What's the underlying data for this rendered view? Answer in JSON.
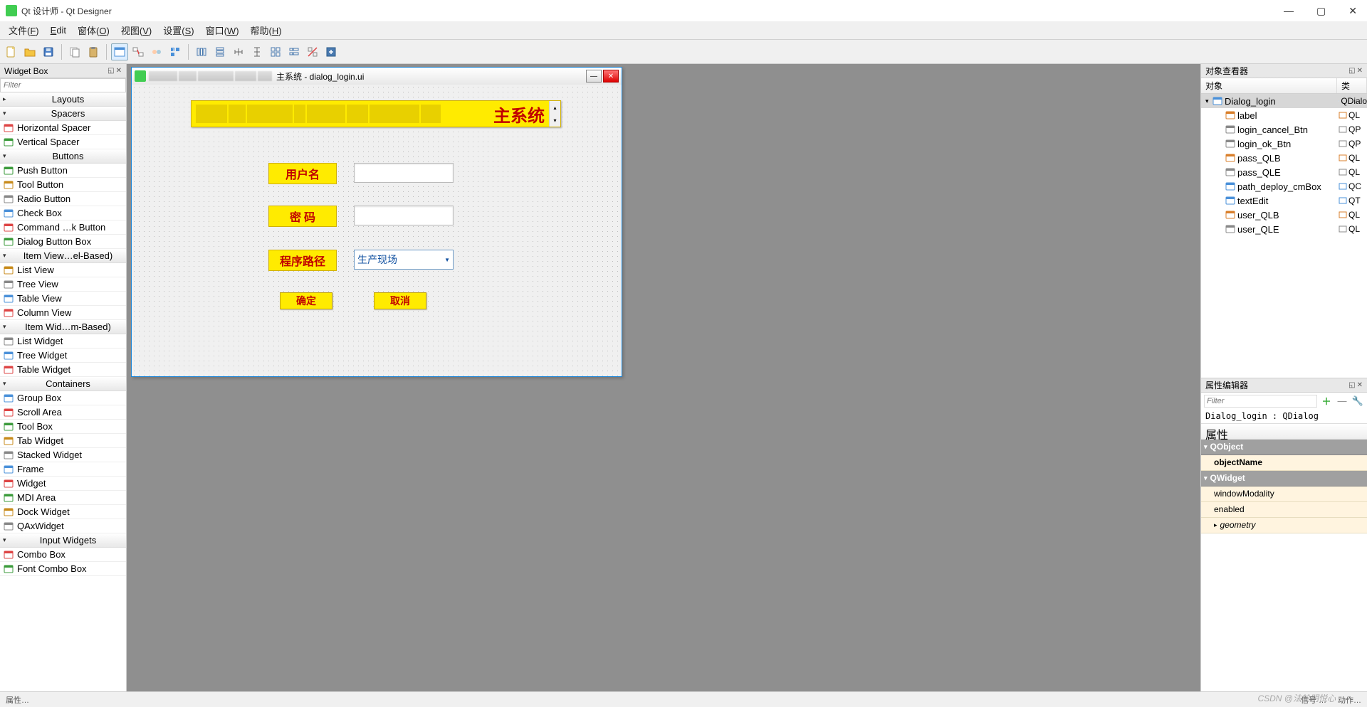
{
  "titlebar": {
    "app_name": "Qt 设计师 - Qt Designer"
  },
  "window_controls": {
    "min": "—",
    "max": "▢",
    "close": "✕"
  },
  "menubar": [
    {
      "label": "文件",
      "accel": "F"
    },
    {
      "label": "Edit",
      "accel": ""
    },
    {
      "label": "窗体",
      "accel": "O"
    },
    {
      "label": "视图",
      "accel": "V"
    },
    {
      "label": "设置",
      "accel": "S"
    },
    {
      "label": "窗口",
      "accel": "W"
    },
    {
      "label": "帮助",
      "accel": "H"
    }
  ],
  "widget_box": {
    "title": "Widget Box",
    "filter_placeholder": "Filter",
    "groups": [
      {
        "name": "Layouts",
        "open": false,
        "items": []
      },
      {
        "name": "Spacers",
        "open": true,
        "items": [
          "Horizontal Spacer",
          "Vertical Spacer"
        ]
      },
      {
        "name": "Buttons",
        "open": true,
        "items": [
          "Push Button",
          "Tool Button",
          "Radio Button",
          "Check Box",
          "Command …k Button",
          "Dialog Button Box"
        ]
      },
      {
        "name": "Item View…el-Based)",
        "open": true,
        "items": [
          "List View",
          "Tree View",
          "Table View",
          "Column View"
        ]
      },
      {
        "name": "Item Wid…m-Based)",
        "open": true,
        "items": [
          "List Widget",
          "Tree Widget",
          "Table Widget"
        ]
      },
      {
        "name": "Containers",
        "open": true,
        "items": [
          "Group Box",
          "Scroll Area",
          "Tool Box",
          "Tab Widget",
          "Stacked Widget",
          "Frame",
          "Widget",
          "MDI Area",
          "Dock Widget",
          "QAxWidget"
        ]
      },
      {
        "name": "Input Widgets",
        "open": true,
        "items": [
          "Combo Box",
          "Font Combo Box"
        ]
      }
    ]
  },
  "form": {
    "window_title": "主系统 - dialog_login.ui",
    "banner_text": "主系统",
    "user_label": "用户名",
    "pass_label": "密   码",
    "path_label": "程序路径",
    "combo_value": "生产现场",
    "ok_label": "确定",
    "cancel_label": "取消"
  },
  "inspector": {
    "title": "对象查看器",
    "col_obj": "对象",
    "col_class": "类",
    "items": [
      {
        "name": "Dialog_login",
        "cls": "QDialo",
        "depth": 0,
        "sel": true,
        "arrow": "▾",
        "iconColor": "#4a90d9"
      },
      {
        "name": "label",
        "cls": "QL",
        "depth": 1,
        "iconColor": "#d97f2b"
      },
      {
        "name": "login_cancel_Btn",
        "cls": "QP",
        "depth": 1,
        "iconColor": "#888"
      },
      {
        "name": "login_ok_Btn",
        "cls": "QP",
        "depth": 1,
        "iconColor": "#888"
      },
      {
        "name": "pass_QLB",
        "cls": "QL",
        "depth": 1,
        "iconColor": "#d97f2b"
      },
      {
        "name": "pass_QLE",
        "cls": "QL",
        "depth": 1,
        "iconColor": "#888"
      },
      {
        "name": "path_deploy_cmBox",
        "cls": "QC",
        "depth": 1,
        "iconColor": "#4a90d9"
      },
      {
        "name": "textEdit",
        "cls": "QT",
        "depth": 1,
        "iconColor": "#4a90d9"
      },
      {
        "name": "user_QLB",
        "cls": "QL",
        "depth": 1,
        "iconColor": "#d97f2b"
      },
      {
        "name": "user_QLE",
        "cls": "QL",
        "depth": 1,
        "iconColor": "#888"
      }
    ]
  },
  "prop_editor": {
    "title": "属性编辑器",
    "filter_placeholder": "Filter",
    "obj_line": "Dialog_login : QDialog",
    "col_prop": "属性",
    "groups": [
      {
        "name": "QObject",
        "rows": [
          {
            "name": "objectName",
            "sel": true
          }
        ]
      },
      {
        "name": "QWidget",
        "rows": [
          {
            "name": "windowModality"
          },
          {
            "name": "enabled"
          },
          {
            "name": "geometry",
            "italic": true,
            "arrow": true
          }
        ]
      }
    ]
  },
  "statusbar": {
    "left": "属性…",
    "signal": "信号 …",
    "action": "动作…"
  },
  "watermark": "CSDN @法轮明悦心"
}
